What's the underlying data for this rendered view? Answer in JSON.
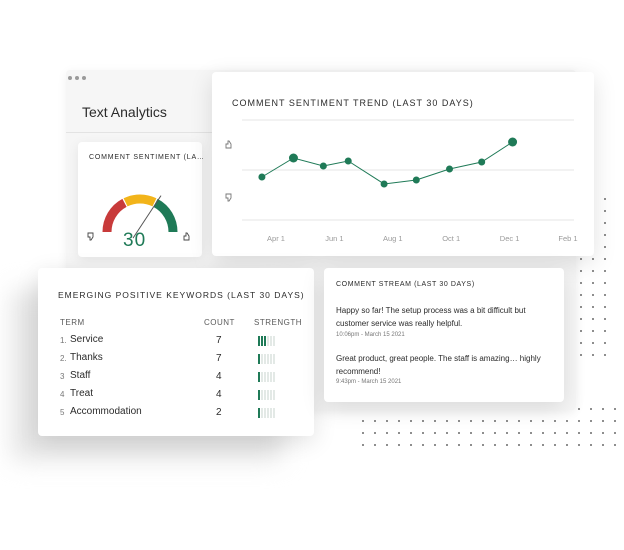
{
  "app": {
    "title": "Text Analytics"
  },
  "gauge": {
    "title": "COMMENT SENTIMENT (LA…",
    "value": "30",
    "value_numeric": 30,
    "min_icon": "thumbs-down-icon",
    "max_icon": "thumbs-up-icon",
    "colors": {
      "negative": "#c83a3a",
      "neutral": "#f2b41a",
      "positive": "#1f7a57",
      "value": "#1f7a57"
    }
  },
  "trend": {
    "title": "COMMENT SENTIMENT TREND (LAST 30 DAYS)",
    "up_icon": "thumbs-up-icon",
    "down_icon": "thumbs-down-icon"
  },
  "chart_data": {
    "type": "line",
    "x_tick_labels": [
      "Apr 1",
      "Jun 1",
      "Aug 1",
      "Oct 1",
      "Dec 1",
      "Feb 1"
    ],
    "y_scale": "sentiment (thumbs-down to thumbs-up)",
    "ylim": [
      0,
      1
    ],
    "gridlines": 3,
    "series": [
      {
        "color": "#1f7a57",
        "points": [
          {
            "x": 0.06,
            "y": 0.43
          },
          {
            "x": 0.155,
            "y": 0.62
          },
          {
            "x": 0.245,
            "y": 0.54
          },
          {
            "x": 0.32,
            "y": 0.59
          },
          {
            "x": 0.428,
            "y": 0.36
          },
          {
            "x": 0.525,
            "y": 0.4
          },
          {
            "x": 0.625,
            "y": 0.51
          },
          {
            "x": 0.722,
            "y": 0.58
          },
          {
            "x": 0.815,
            "y": 0.78
          }
        ]
      }
    ]
  },
  "keywords": {
    "title": "EMERGING POSITIVE KEYWORDS (LAST 30 DAYS)",
    "headers": {
      "term": "TERM",
      "count": "COUNT",
      "strength": "STRENGTH"
    },
    "rows": [
      {
        "num": "1.",
        "term": "Service",
        "count": "7",
        "strength": 3
      },
      {
        "num": "2.",
        "term": "Thanks",
        "count": "7",
        "strength": 1
      },
      {
        "num": "3",
        "term": "Staff",
        "count": "4",
        "strength": 1
      },
      {
        "num": "4",
        "term": "Treat",
        "count": "4",
        "strength": 1
      },
      {
        "num": "5",
        "term": "Accommodation",
        "count": "2",
        "strength": 1
      }
    ],
    "strength_max": 6,
    "strength_color": "#1f7a57"
  },
  "stream": {
    "title": "COMMENT STREAM (LAST 30 DAYS)",
    "items": [
      {
        "text": "Happy so far! The setup process was a bit difficult but customer service was really helpful.",
        "time": "10:06pm - March 15 2021"
      },
      {
        "text": "Great product, great people. The staff is amazing… highly recommend!",
        "time": "9:43pm - March 15 2021"
      }
    ]
  }
}
